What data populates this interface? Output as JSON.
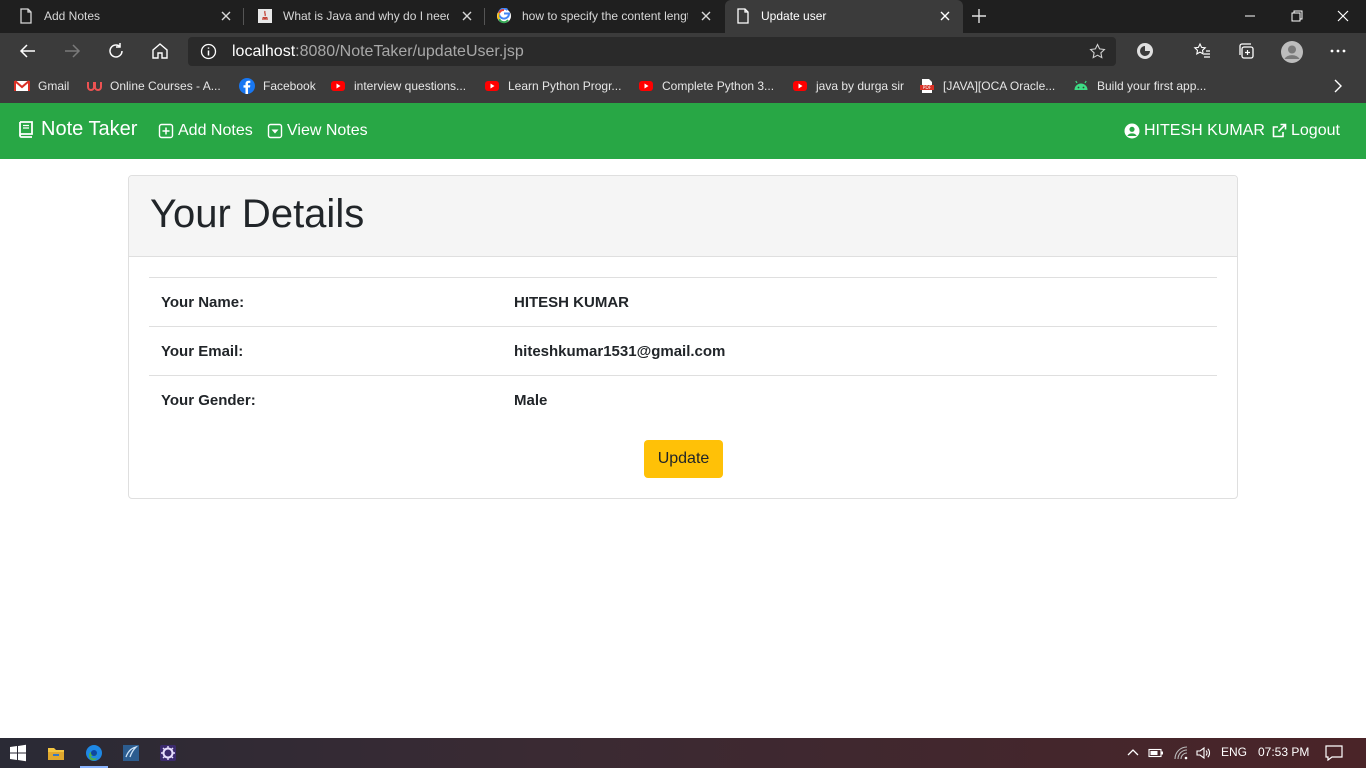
{
  "browser": {
    "tabs": [
      {
        "title": "Add Notes",
        "icon": "page-icon"
      },
      {
        "title": "What is Java and why do I need it",
        "icon": "java-icon"
      },
      {
        "title": "how to specify the content length",
        "icon": "google-icon"
      },
      {
        "title": "Update user",
        "icon": "page-icon",
        "active": true
      }
    ],
    "address": {
      "host": "localhost",
      "rest": ":8080/NoteTaker/updateUser.jsp"
    },
    "bookmarks": [
      {
        "label": "Gmail",
        "icon": "gmail-icon"
      },
      {
        "label": "Online Courses - A...",
        "icon": "udemy-icon"
      },
      {
        "label": "Facebook",
        "icon": "facebook-icon"
      },
      {
        "label": "interview questions...",
        "icon": "youtube-icon"
      },
      {
        "label": "Learn Python Progr...",
        "icon": "youtube-icon"
      },
      {
        "label": "Complete Python 3...",
        "icon": "youtube-icon"
      },
      {
        "label": "java by durga sir",
        "icon": "youtube-icon"
      },
      {
        "label": "[JAVA][OCA Oracle...",
        "icon": "pdf-icon"
      },
      {
        "label": "Build your first app...",
        "icon": "android-icon"
      }
    ]
  },
  "app": {
    "brand": "Note Taker",
    "nav": {
      "add_notes": "Add Notes",
      "view_notes": "View Notes",
      "user": "HITESH KUMAR",
      "logout": "Logout"
    },
    "colors": {
      "navbar": "#28a745",
      "button": "#ffc107"
    }
  },
  "card": {
    "title": "Your Details",
    "rows": [
      {
        "label": "Your Name:",
        "value": "HITESH KUMAR"
      },
      {
        "label": "Your Email:",
        "value": "hiteshkumar1531@gmail.com"
      },
      {
        "label": "Your Gender:",
        "value": "Male"
      }
    ],
    "button": "Update"
  },
  "taskbar": {
    "lang": "ENG",
    "time": "07:53 PM"
  }
}
